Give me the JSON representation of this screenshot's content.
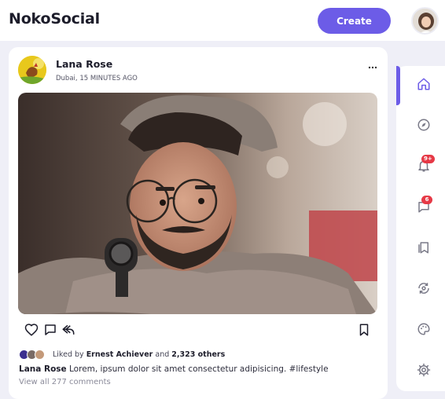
{
  "app": {
    "name": "NokoSocial"
  },
  "header": {
    "create_label": "Create"
  },
  "post": {
    "author": "Lana Rose",
    "location": "Dubai",
    "time": "15 MINUTES AGO",
    "liked_by_prefix": "Liked by",
    "liked_by_name": "Ernest Achiever",
    "liked_by_joiner": "and",
    "liked_by_others": "2,323 others",
    "caption_author": "Lana Rose",
    "caption_text": "Lorem, ipsum dolor sit amet consectetur adipisicing.",
    "caption_hashtag": "#lifestyle",
    "comments_link": "View all 277 comments"
  },
  "sidebar": {
    "items": [
      {
        "name": "home",
        "icon": "home-icon",
        "active": true
      },
      {
        "name": "explore",
        "icon": "compass-icon"
      },
      {
        "name": "notifications",
        "icon": "bell-icon",
        "badge": "9+"
      },
      {
        "name": "messages",
        "icon": "message-icon",
        "badge": "6"
      },
      {
        "name": "bookmarks",
        "icon": "bookmarks-icon"
      },
      {
        "name": "analytics",
        "icon": "refresh-icon"
      },
      {
        "name": "theme",
        "icon": "palette-icon"
      },
      {
        "name": "settings",
        "icon": "gear-icon"
      }
    ]
  },
  "colors": {
    "accent": "#6c5ce7",
    "badge": "#e63946",
    "background": "#efeff7"
  }
}
